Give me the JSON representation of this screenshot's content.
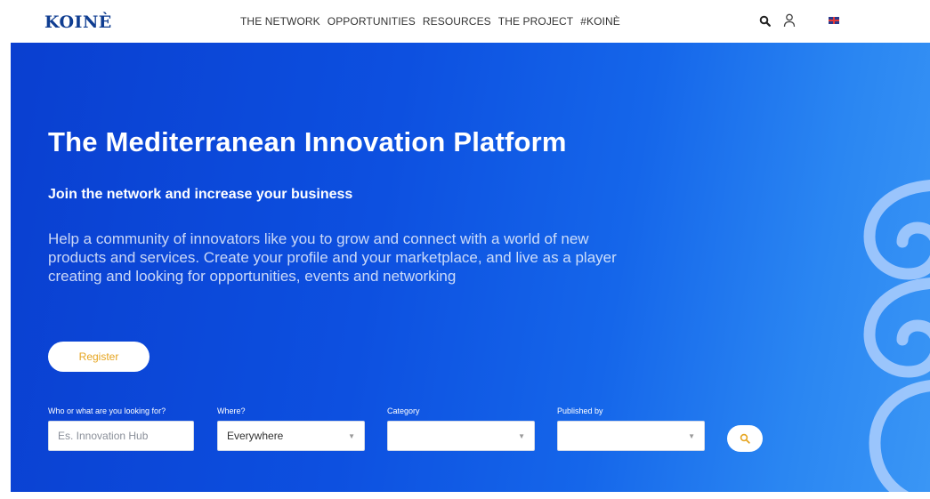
{
  "header": {
    "logo": "KOINÈ",
    "nav": [
      {
        "label": "THE NETWORK"
      },
      {
        "label": "OPPORTUNITIES"
      },
      {
        "label": "RESOURCES"
      },
      {
        "label": "THE PROJECT"
      },
      {
        "label": "#KOINÈ"
      }
    ],
    "icons": [
      "search-icon",
      "user-icon",
      "uk-flag-icon"
    ]
  },
  "hero": {
    "title": "The Mediterranean Innovation Platform",
    "subtitle": "Join the network and increase your business",
    "description": "Help a community of innovators like you to grow and connect with a world of new products and services. Create your profile and your marketplace, and live as a player creating and looking for opportunities, events and networking",
    "register_label": "Register"
  },
  "search": {
    "who_label": "Who or what are you looking for?",
    "who_placeholder": "Es. Innovation Hub",
    "where_label": "Where?",
    "where_value": "Everywhere",
    "category_label": "Category",
    "category_value": "",
    "published_label": "Published by",
    "published_value": ""
  },
  "colors": {
    "brand": "#0f3d91",
    "hero_start": "#0a3fd0",
    "hero_end": "#3a96f5",
    "accent": "#e6a520"
  }
}
